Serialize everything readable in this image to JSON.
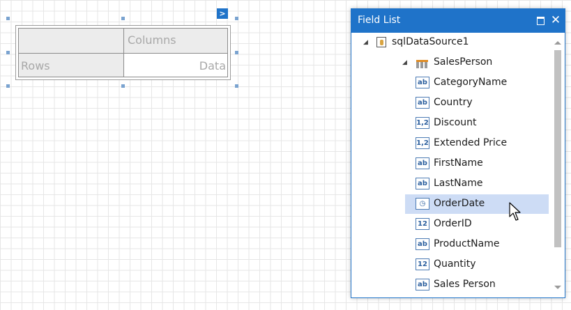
{
  "pivot": {
    "columns_label": "Columns",
    "rows_label": "Rows",
    "data_label": "Data",
    "smart_tag_glyph": ">"
  },
  "field_list": {
    "title": "Field List",
    "close_glyph": "✕",
    "data_source": "sqlDataSource1",
    "table": "SalesPerson",
    "fields": [
      {
        "name": "CategoryName",
        "type_badge": "ab"
      },
      {
        "name": "Country",
        "type_badge": "ab"
      },
      {
        "name": "Discount",
        "type_badge": "1,2"
      },
      {
        "name": "Extended Price",
        "type_badge": "1,2"
      },
      {
        "name": "FirstName",
        "type_badge": "ab"
      },
      {
        "name": "LastName",
        "type_badge": "ab"
      },
      {
        "name": "OrderDate",
        "type_badge": "◷"
      },
      {
        "name": "OrderID",
        "type_badge": "12"
      },
      {
        "name": "ProductName",
        "type_badge": "ab"
      },
      {
        "name": "Quantity",
        "type_badge": "12"
      },
      {
        "name": "Sales Person",
        "type_badge": "ab"
      }
    ],
    "selected_field": "OrderDate"
  },
  "colors": {
    "accent": "#1f73c9",
    "selection": "#cddcf5"
  }
}
